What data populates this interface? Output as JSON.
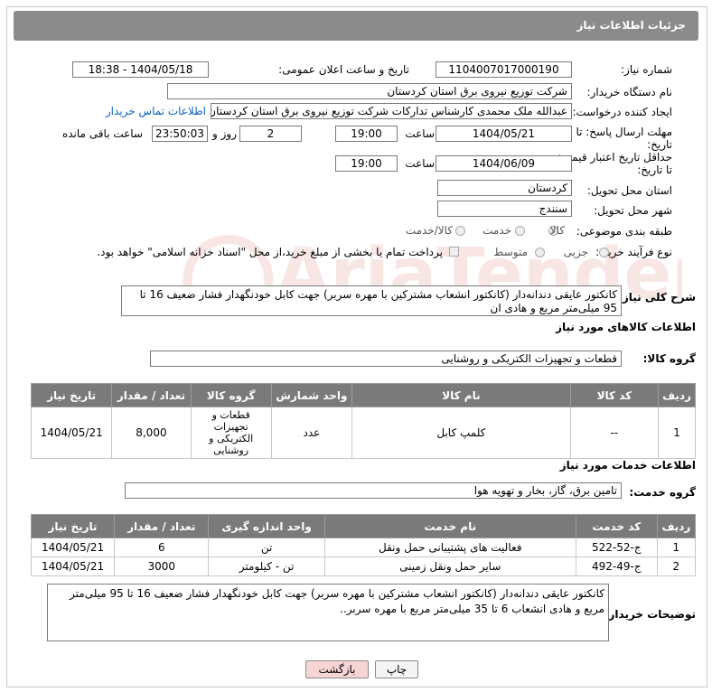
{
  "header": {
    "title": "جزئیات اطلاعات نیاز"
  },
  "form": {
    "need_number": {
      "label": "شماره نیاز:",
      "value": "1104007017000190"
    },
    "announce_datetime": {
      "label": "تاریخ و ساعت اعلان عمومی:",
      "value": "1404/05/18 - 18:38"
    },
    "buyer_org": {
      "label": "نام دستگاه خریدار:",
      "value": "شرکت توزیع نیروی برق استان کردستان"
    },
    "requester": {
      "label": "ایجاد کننده درخواست:",
      "value": "عبدالله ملک محمدی کارشناس تدارکات شرکت توزیع نیروی برق استان کردستان",
      "contact_link": "اطلاعات تماس خریدار"
    },
    "reply_deadline": {
      "label_line1": "مهلت ارسال پاسخ: تا",
      "label_line2": "تاریخ:",
      "date": "1404/05/21",
      "time_label": "ساعت",
      "time": "19:00",
      "days": "2",
      "days_label": "روز و",
      "remaining": "23:50:03",
      "remaining_label": "ساعت باقی مانده"
    },
    "price_validity": {
      "label_line1": "حداقل تاریخ اعتبار قیمت:",
      "label_line2": "تا تاریخ:",
      "date": "1404/06/09",
      "time_label": "ساعت",
      "time": "19:00"
    },
    "delivery_province": {
      "label": "استان محل تحویل:",
      "value": "کردستان"
    },
    "delivery_city": {
      "label": "شهر محل تحویل:",
      "value": "سنندج"
    },
    "subject_category": {
      "label": "طبقه بندی موضوعی:",
      "options": [
        "کالا",
        "خدمت",
        "کالا/خدمت"
      ]
    },
    "process_type": {
      "label": "نوع فرآیند خرید :",
      "options": [
        "جزیی",
        "متوسط"
      ],
      "payment_note": "پرداخت تمام یا بخشی از مبلغ خرید،از محل \"اسناد خزانه اسلامی\" خواهد بود."
    }
  },
  "description": {
    "label": "شرح کلی نیاز:",
    "text": "کانکتور عایقی دندانه‌دار (کانکتور انشعاب مشترکین با مهره سربر) جهت کابل خودنگهدار فشار ضعیف 16 تا 95 میلی‌متر مربع و هادی ان"
  },
  "goods": {
    "section_title": "اطلاعات کالاهای مورد نیاز",
    "group_label": "گروه کالا:",
    "group_value": "قطعات و تجهیزات الکتریکی و روشنایی",
    "columns": [
      "ردیف",
      "کد کالا",
      "نام کالا",
      "واحد شمارش",
      "گروه کالا",
      "تعداد / مقدار",
      "تاریخ نیاز"
    ],
    "rows": [
      {
        "row": "1",
        "code": "--",
        "name": "کلمپ کابل",
        "unit": "عدد",
        "group": "قطعات و تجهیزات الکتریکی و روشنایی",
        "qty": "8,000",
        "date": "1404/05/21"
      }
    ]
  },
  "services": {
    "section_title": "اطلاعات خدمات مورد نیاز",
    "group_label": "گروه خدمت:",
    "group_value": "تامین برق، گاز، بخار و تهویه هوا",
    "columns": [
      "ردیف",
      "کد خدمت",
      "نام خدمت",
      "واحد اندازه گیری",
      "تعداد / مقدار",
      "تاریخ نیاز"
    ],
    "rows": [
      {
        "row": "1",
        "code": "ج-52-522",
        "name": "فعالیت های پشتیبانی حمل ونقل",
        "unit": "تن",
        "qty": "6",
        "date": "1404/05/21"
      },
      {
        "row": "2",
        "code": "ج-49-492",
        "name": "سایر حمل ونقل زمینی",
        "unit": "تن - کیلومتر",
        "qty": "3000",
        "date": "1404/05/21"
      }
    ]
  },
  "buyer_notes": {
    "label": "توضیحات خریدار:",
    "text": "کانکتور عایقی دندانه‌دار (کانکتور انشعاب مشترکین با مهره سربر) جهت کابل خودنگهدار فشار ضعیف 16 تا 95 میلی‌متر مربع و هادی انشعاب 6 تا 35 میلی‌متر مربع با مهره سربر.."
  },
  "buttons": {
    "print": "چاپ",
    "back": "بازگشت"
  },
  "colors": {
    "header_bg": "#8b8b8b",
    "table_header_bg": "#7a7a7a",
    "link": "#0b62c9",
    "back_button_bg": "#f7d5d5",
    "watermark": "#c0392b"
  }
}
